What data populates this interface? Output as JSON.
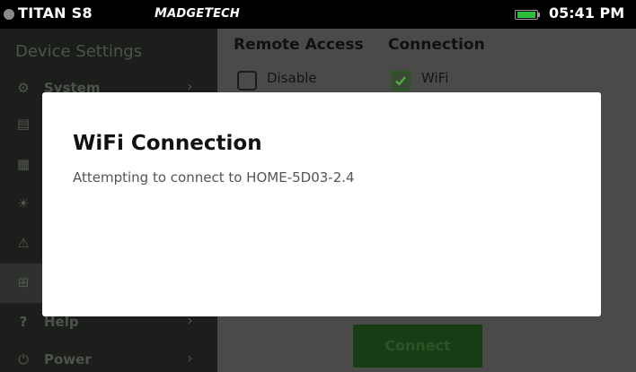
{
  "status_bar": {
    "device": "TITAN S8",
    "brand_first_M": "M",
    "brand_rest_adge": "ADGE",
    "brand_T": "T",
    "brand_rest_ech": "ECH",
    "time": "05:41 PM",
    "battery_level": 0.9,
    "battery_color": "#2dbd3a"
  },
  "sidebar": {
    "title": "Device Settings",
    "items": [
      {
        "label": "System",
        "icon": "gear-icon",
        "glyph": "⚙"
      },
      {
        "label": "",
        "icon": "save-icon",
        "glyph": "▤"
      },
      {
        "label": "",
        "icon": "calendar-icon",
        "glyph": "▦"
      },
      {
        "label": "",
        "icon": "brightness-icon",
        "glyph": "☀"
      },
      {
        "label": "",
        "icon": "alarm-icon",
        "glyph": "⚠"
      },
      {
        "label": "",
        "icon": "network-icon",
        "glyph": "⊞"
      },
      {
        "label": "Help",
        "icon": "help-icon",
        "glyph": "?"
      },
      {
        "label": "Power",
        "icon": "power-icon",
        "glyph": "⏻"
      }
    ],
    "active_index": 5
  },
  "main": {
    "remote_access_heading": "Remote Access",
    "connection_heading": "Connection",
    "disable_label": "Disable",
    "disable_checked": false,
    "wifi_label": "WiFi",
    "wifi_checked": true,
    "connect_label": "Connect",
    "accent_color": "#3bb34a"
  },
  "modal": {
    "title": "WiFi Connection",
    "message": "Attempting to connect to HOME-5D03-2.4"
  }
}
